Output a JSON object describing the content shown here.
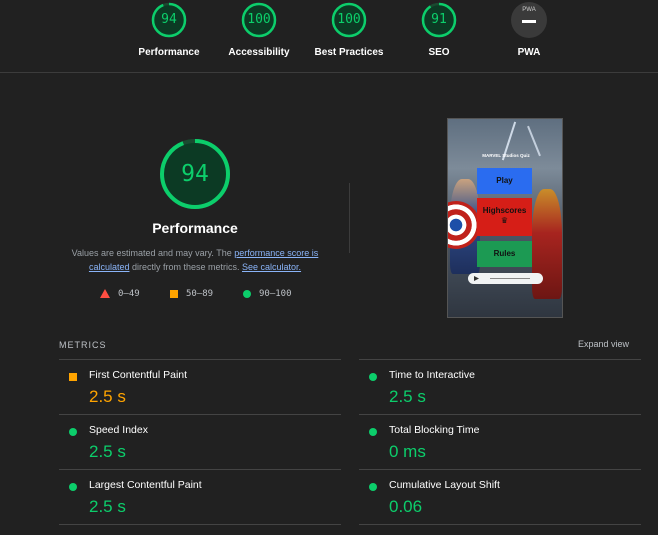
{
  "top_gauges": [
    {
      "score": "94",
      "label": "Performance"
    },
    {
      "score": "100",
      "label": "Accessibility"
    },
    {
      "score": "100",
      "label": "Best Practices"
    },
    {
      "score": "91",
      "label": "SEO"
    }
  ],
  "pwa": {
    "badge": "PWA",
    "label": "PWA"
  },
  "performance": {
    "score": "94",
    "title": "Performance",
    "desc_prefix": "Values are estimated and may vary. The ",
    "score_link": "performance score is calculated",
    "desc_mid": " directly from these metrics. ",
    "calc_link": "See calculator."
  },
  "legend": {
    "fail": "0–49",
    "average": "50–89",
    "pass": "90–100"
  },
  "thumbnail": {
    "app_title": "MARVEL Studios Quiz",
    "play": "Play",
    "highscores": "Highscores",
    "crown": "♛",
    "rules": "Rules"
  },
  "metrics_header": "METRICS",
  "expand_view": "Expand view",
  "metrics": [
    {
      "name": "First Contentful Paint",
      "value": "2.5 s"
    },
    {
      "name": "Time to Interactive",
      "value": "2.5 s"
    },
    {
      "name": "Speed Index",
      "value": "2.5 s"
    },
    {
      "name": "Total Blocking Time",
      "value": "0 ms"
    },
    {
      "name": "Largest Contentful Paint",
      "value": "2.5 s"
    },
    {
      "name": "Cumulative Layout Shift",
      "value": "0.06"
    }
  ],
  "colors": {
    "pass": "#0cce6b",
    "average": "#ffa400",
    "fail": "#ff4e42",
    "link": "#8ab4f8",
    "background": "#212121"
  }
}
